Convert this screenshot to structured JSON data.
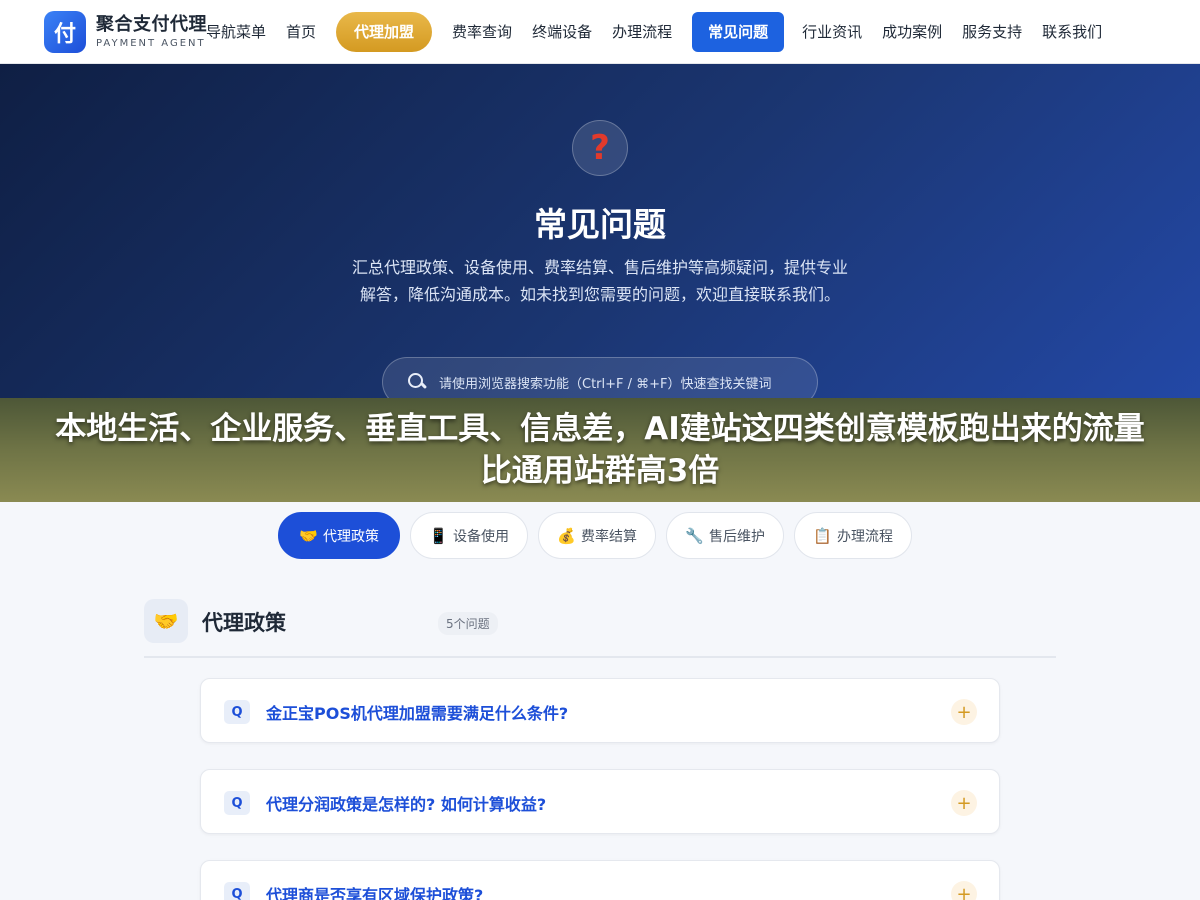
{
  "header": {
    "logo_glyph": "付",
    "logo_title": "聚合支付代理",
    "logo_subtitle": "PAYMENT AGENT",
    "nav": [
      {
        "label": "导航菜单"
      },
      {
        "label": "首页"
      },
      {
        "label": "代理加盟"
      },
      {
        "label": "费率查询"
      },
      {
        "label": "终端设备"
      },
      {
        "label": "办理流程"
      },
      {
        "label": "常见问题"
      },
      {
        "label": "行业资讯"
      },
      {
        "label": "成功案例"
      },
      {
        "label": "服务支持"
      },
      {
        "label": "联系我们"
      }
    ]
  },
  "hero": {
    "icon": "question-mark-icon",
    "title": "常见问题",
    "description": "汇总代理政策、设备使用、费率结算、售后维护等高频疑问，提供专业解答，降低沟通成本。如未找到您需要的问题，欢迎直接联系我们。",
    "search_hint": "请使用浏览器搜索功能（Ctrl+F / ⌘+F）快速查找关键词"
  },
  "banner": {
    "text": "本地生活、企业服务、垂直工具、信息差，AI建站这四类创意模板跑出来的流量比通用站群高3倍"
  },
  "tabs": [
    {
      "icon": "🤝",
      "label": "代理政策",
      "active": true
    },
    {
      "icon": "📱",
      "label": "设备使用",
      "active": false
    },
    {
      "icon": "💰",
      "label": "费率结算",
      "active": false
    },
    {
      "icon": "🔧",
      "label": "售后维护",
      "active": false
    },
    {
      "icon": "📋",
      "label": "办理流程",
      "active": false
    }
  ],
  "section": {
    "icon": "🤝",
    "title": "代理政策",
    "count": "5个问题"
  },
  "faqs": [
    {
      "badge": "Q",
      "question": "金正宝POS机代理加盟需要满足什么条件?",
      "toggle": "+"
    },
    {
      "badge": "Q",
      "question": "代理分润政策是怎样的? 如何计算收益?",
      "toggle": "+"
    },
    {
      "badge": "Q",
      "question": "代理商是否享有区域保护政策?",
      "toggle": "+"
    }
  ],
  "colors": {
    "accent": "#1d4fd8",
    "gold": "#d49a22",
    "hero_dark": "#0f1f44"
  }
}
